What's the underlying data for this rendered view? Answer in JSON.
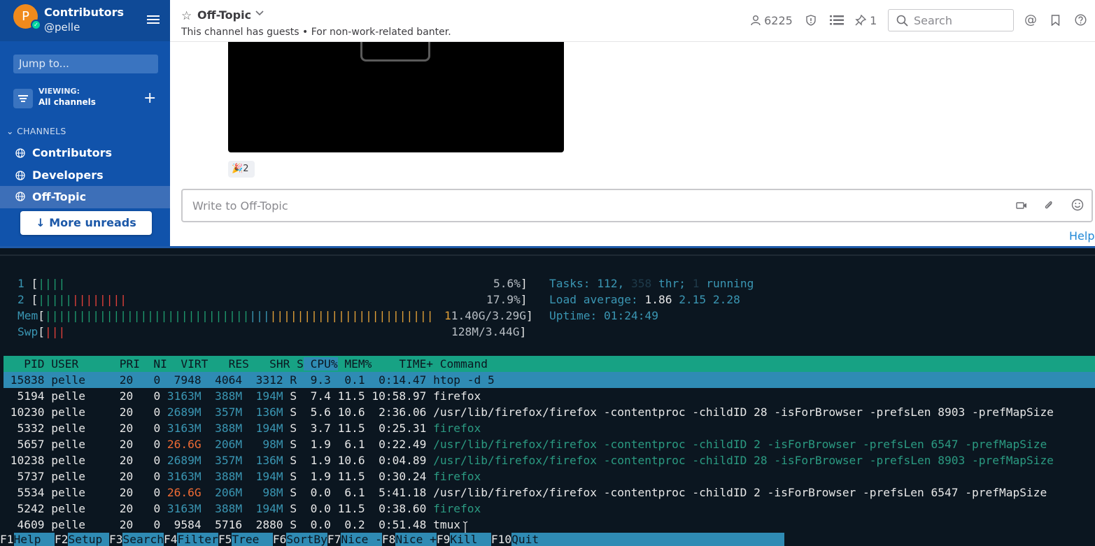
{
  "sidebar": {
    "team_initial": "P",
    "team_name": "Contributors",
    "username": "@pelle",
    "jump_placeholder": "Jump to...",
    "viewing_label": "VIEWING:",
    "viewing_value": "All channels",
    "channels_header": "CHANNELS",
    "channels": [
      "Contributors",
      "Developers",
      "Off-Topic"
    ],
    "more_unreads": "More unreads"
  },
  "header": {
    "channel_name": "Off-Topic",
    "channel_description": "This channel has guests • For non-work-related banter.",
    "members_count": "6225",
    "pinned_count": "1",
    "search_placeholder": "Search"
  },
  "post": {
    "reaction_emoji": "🎉",
    "reaction_count": "2",
    "input_placeholder": "Write to Off-Topic",
    "help_link": "Help"
  },
  "htop": {
    "cpu1": {
      "label": "1",
      "percent": "5.6%"
    },
    "cpu2": {
      "label": "2",
      "percent": "17.9%"
    },
    "mem": {
      "label": "Mem",
      "value": "1.40G/3.29G"
    },
    "swp": {
      "label": "Swp",
      "value": "128M/3.44G"
    },
    "tasks_label": "Tasks:",
    "tasks": "112,",
    "threads": "358",
    "threads_label": "thr;",
    "running": "1",
    "running_label": "running",
    "load_label": "Load average:",
    "load1": "1.86",
    "load5": "2.15",
    "load15": "2.28",
    "uptime_label": "Uptime:",
    "uptime": "01:24:49",
    "columns": [
      "PID",
      "USER",
      "PRI",
      "NI",
      "VIRT",
      "RES",
      "SHR",
      "S",
      "CPU%",
      "MEM%",
      "TIME+",
      "Command"
    ],
    "processes": [
      {
        "pid": "15838",
        "user": "pelle",
        "pri": "20",
        "ni": "0",
        "virt": "7948",
        "res": "4064",
        "shr": "3312",
        "s": "R",
        "cpu": "9.3",
        "mem": "0.1",
        "time": "0:14.47",
        "cmd": "htop -d 5"
      },
      {
        "pid": "5194",
        "user": "pelle",
        "pri": "20",
        "ni": "0",
        "virt": "3163M",
        "res": "388M",
        "shr": "194M",
        "s": "S",
        "cpu": "7.4",
        "mem": "11.5",
        "time": "10:58.97",
        "cmd": "firefox"
      },
      {
        "pid": "10230",
        "user": "pelle",
        "pri": "20",
        "ni": "0",
        "virt": "2689M",
        "res": "357M",
        "shr": "136M",
        "s": "S",
        "cpu": "5.6",
        "mem": "10.6",
        "time": "2:36.06",
        "cmd": "/usr/lib/firefox/firefox -contentproc -childID 28 -isForBrowser -prefsLen 8903 -prefMapSize"
      },
      {
        "pid": "5332",
        "user": "pelle",
        "pri": "20",
        "ni": "0",
        "virt": "3163M",
        "res": "388M",
        "shr": "194M",
        "s": "S",
        "cpu": "3.7",
        "mem": "11.5",
        "time": "0:25.31",
        "cmd": "firefox"
      },
      {
        "pid": "5657",
        "user": "pelle",
        "pri": "20",
        "ni": "0",
        "virt": "26.6G",
        "res": "206M",
        "shr": "98M",
        "s": "S",
        "cpu": "1.9",
        "mem": "6.1",
        "time": "0:22.49",
        "cmd": "/usr/lib/firefox/firefox -contentproc -childID 2 -isForBrowser -prefsLen 6547 -prefMapSize"
      },
      {
        "pid": "10238",
        "user": "pelle",
        "pri": "20",
        "ni": "0",
        "virt": "2689M",
        "res": "357M",
        "shr": "136M",
        "s": "S",
        "cpu": "1.9",
        "mem": "10.6",
        "time": "0:04.89",
        "cmd": "/usr/lib/firefox/firefox -contentproc -childID 28 -isForBrowser -prefsLen 8903 -prefMapSize"
      },
      {
        "pid": "5737",
        "user": "pelle",
        "pri": "20",
        "ni": "0",
        "virt": "3163M",
        "res": "388M",
        "shr": "194M",
        "s": "S",
        "cpu": "1.9",
        "mem": "11.5",
        "time": "0:30.24",
        "cmd": "firefox"
      },
      {
        "pid": "5534",
        "user": "pelle",
        "pri": "20",
        "ni": "0",
        "virt": "26.6G",
        "res": "206M",
        "shr": "98M",
        "s": "S",
        "cpu": "0.0",
        "mem": "6.1",
        "time": "5:41.18",
        "cmd": "/usr/lib/firefox/firefox -contentproc -childID 2 -isForBrowser -prefsLen 6547 -prefMapSize"
      },
      {
        "pid": "5242",
        "user": "pelle",
        "pri": "20",
        "ni": "0",
        "virt": "3163M",
        "res": "388M",
        "shr": "194M",
        "s": "S",
        "cpu": "0.0",
        "mem": "11.5",
        "time": "0:38.60",
        "cmd": "firefox"
      },
      {
        "pid": "4609",
        "user": "pelle",
        "pri": "20",
        "ni": "0",
        "virt": "9584",
        "res": "5716",
        "shr": "2880",
        "s": "S",
        "cpu": "0.0",
        "mem": "0.2",
        "time": "0:51.48",
        "cmd": "tmux"
      }
    ],
    "fkeys": [
      {
        "key": "F1",
        "label": "Help"
      },
      {
        "key": "F2",
        "label": "Setup"
      },
      {
        "key": "F3",
        "label": "Search"
      },
      {
        "key": "F4",
        "label": "Filter"
      },
      {
        "key": "F5",
        "label": "Tree"
      },
      {
        "key": "F6",
        "label": "SortBy"
      },
      {
        "key": "F7",
        "label": "Nice -"
      },
      {
        "key": "F8",
        "label": "Nice +"
      },
      {
        "key": "F9",
        "label": "Kill"
      },
      {
        "key": "F10",
        "label": "Quit"
      }
    ]
  },
  "colors": {
    "sidebar_bg": "#1153ab",
    "header_green": "#17a284",
    "selection_blue": "#2f8bb4",
    "terminal_bg": "#0b1620"
  }
}
